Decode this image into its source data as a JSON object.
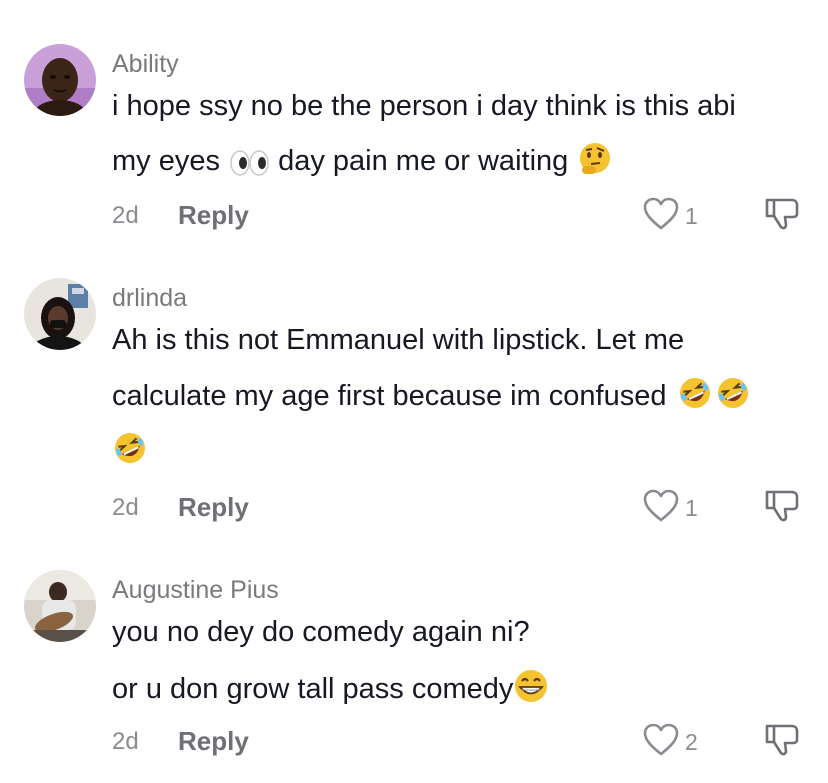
{
  "comments": [
    {
      "username": "Ability",
      "lines": [
        "i hope ssy no be the person i day think is this abi",
        "my eyes",
        "day pain me or waiting"
      ],
      "age": "2d",
      "reply_label": "Reply",
      "like_count": "1",
      "emojis": [
        "eyes-emoji",
        "thinking-face-emoji"
      ]
    },
    {
      "username": "drlinda",
      "lines": [
        "Ah is this not Emmanuel with lipstick. Let me",
        "calculate my age first because im confused"
      ],
      "age": "2d",
      "reply_label": "Reply",
      "like_count": "1",
      "emojis": [
        "rolling-laughing-emoji",
        "rolling-laughing-emoji",
        "rolling-laughing-emoji"
      ]
    },
    {
      "username": "Augustine Pius",
      "lines": [
        "you no dey do comedy again ni?",
        "or u don grow tall pass comedy"
      ],
      "age": "2d",
      "reply_label": "Reply",
      "like_count": "2",
      "emojis": [
        "grinning-face-emoji"
      ]
    }
  ],
  "colors": {
    "username": "#7a7a7e",
    "text": "#161823",
    "meta": "#8a8b91",
    "emoji_face": "#f6c330"
  }
}
